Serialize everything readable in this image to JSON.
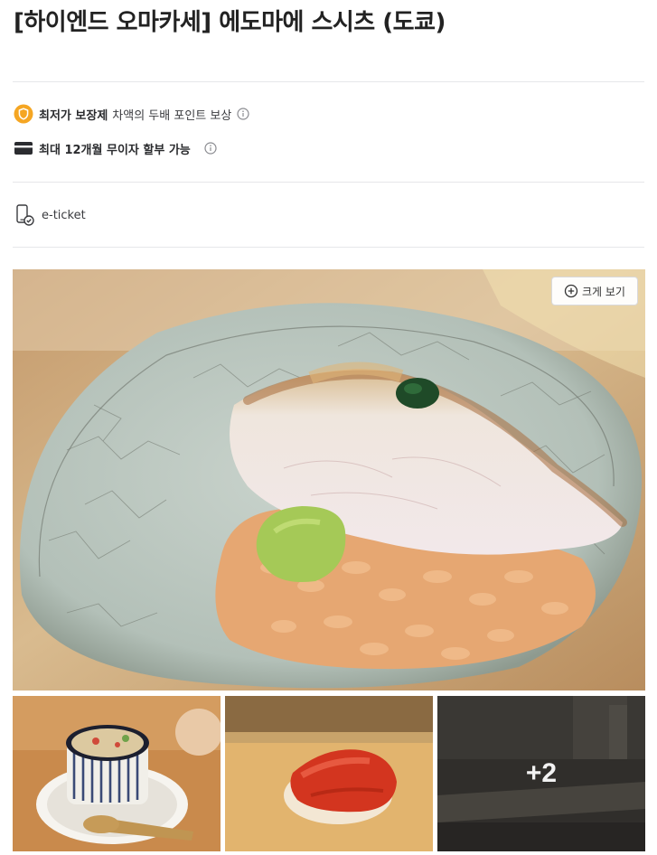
{
  "product": {
    "title": "[하이엔드 오마카세] 에도마에 스시츠 (도쿄)"
  },
  "benefits": [
    {
      "bold": "최저가 보장제",
      "text": "차액의 두배 포인트 보상",
      "icon": "shield-icon",
      "info_icon": "info-icon"
    },
    {
      "bold": "최대 12개월 무이자 할부 가능",
      "text": "",
      "icon": "credit-card-icon",
      "info_icon": "info-icon"
    }
  ],
  "ticket": {
    "label": "e-ticket",
    "icon": "mobile-ticket-icon"
  },
  "gallery": {
    "zoom_label": "크게 보기",
    "more_count": "+2",
    "colors": {
      "accent": "#f5a623"
    }
  }
}
